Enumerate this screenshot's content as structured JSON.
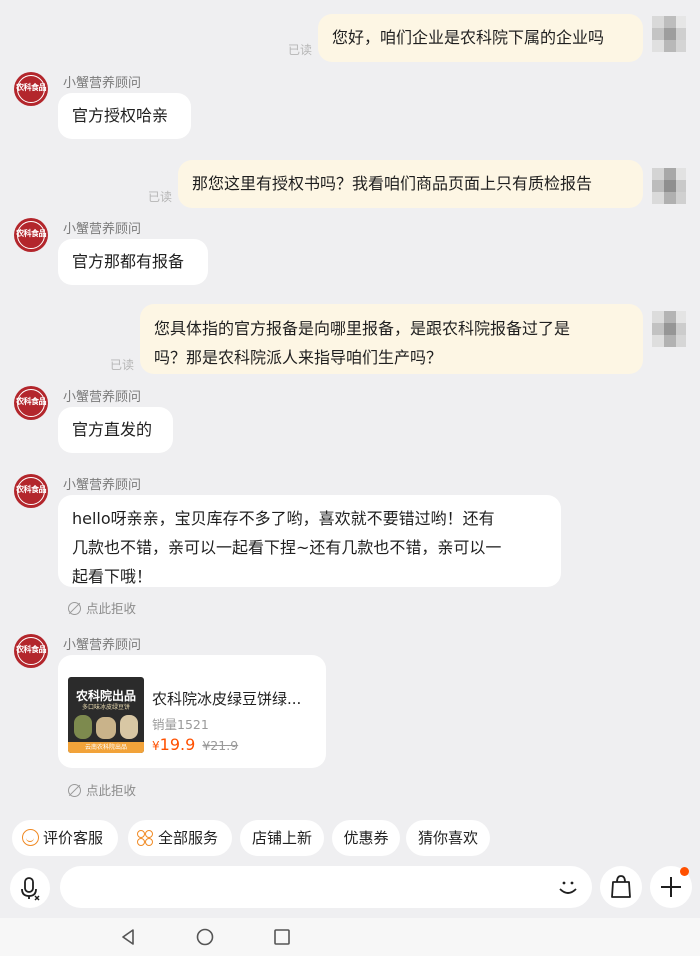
{
  "messages": {
    "m1_text": "您好，咱们企业是农科院下属的企业吗",
    "m1_status": "已读",
    "m2_sender": "小蟹营养顾问",
    "m2_text": "官方授权哈亲",
    "m3_text": "那您这里有授权书吗？我看咱们商品页面上只有质检报告",
    "m3_status": "已读",
    "m4_sender": "小蟹营养顾问",
    "m4_text": "官方那都有报备",
    "m5_line1": "您具体指的官方报备是向哪里报备，是跟农科院报备过了是",
    "m5_line2": "吗？那是农科院派人来指导咱们生产吗？",
    "m5_status": "已读",
    "m6_sender": "小蟹营养顾问",
    "m6_text": "官方直发的",
    "m7_sender": "小蟹营养顾问",
    "m7_line1": "hello呀亲亲，宝贝库存不多了哟，喜欢就不要错过哟！还有",
    "m7_line2": "几款也不错，亲可以一起看下捏~还有几款也不错，亲可以一",
    "m7_line3": "起看下哦！",
    "m7_reject": "点此拒收",
    "m8_sender": "小蟹营养顾问",
    "m8_reject": "点此拒收"
  },
  "avatar": {
    "brand": "农科食品",
    "color": "#b3262c"
  },
  "product": {
    "title": "农科院冰皮绿豆饼绿...",
    "sales": "销量1521",
    "currency": "¥",
    "price": "19.9",
    "original_price": "¥21.9",
    "img_headline": "农科院出品",
    "img_subline": "多口味冰皮绿豆饼",
    "img_footer": "云南农科院出品",
    "price_color": "#ff5000"
  },
  "quick_actions": {
    "review": "评价客服",
    "all_services": "全部服务",
    "new_arrivals": "店铺上新",
    "coupons": "优惠券",
    "guess": "猜你喜欢"
  },
  "icons": {
    "voice": "microphone-icon",
    "emoji": "emoji-icon",
    "cart": "shopping-bag-icon",
    "add": "plus-icon",
    "back": "back-icon",
    "home": "home-icon",
    "recents": "recents-icon"
  }
}
